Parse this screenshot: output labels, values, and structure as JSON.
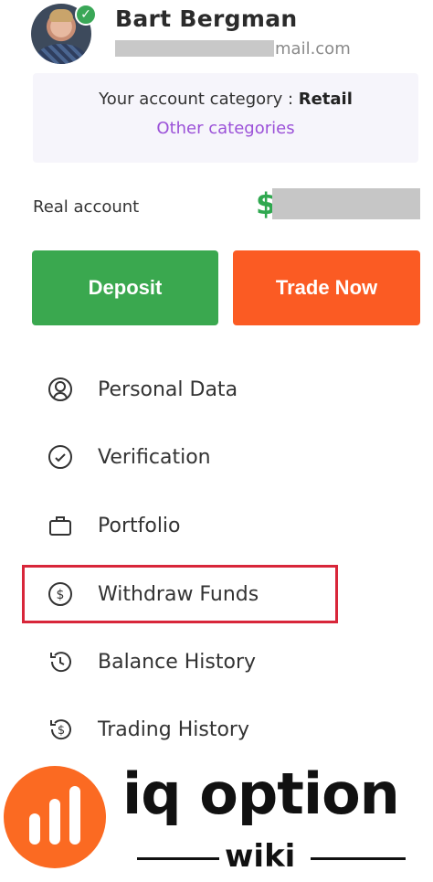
{
  "profile": {
    "name": "Bart Bergman",
    "email_visible_suffix": "mail.com"
  },
  "account_category": {
    "prefix": "Your account category : ",
    "value": "Retail",
    "other_link": "Other categories"
  },
  "balance": {
    "label": "Real account",
    "currency_symbol": "$"
  },
  "actions": {
    "deposit_label": "Deposit",
    "trade_label": "Trade Now"
  },
  "menu": [
    {
      "label": "Personal Data",
      "icon": "user-icon"
    },
    {
      "label": "Verification",
      "icon": "check-circle-icon"
    },
    {
      "label": "Portfolio",
      "icon": "briefcase-icon"
    },
    {
      "label": "Withdraw Funds",
      "icon": "dollar-circle-icon",
      "highlighted": true
    },
    {
      "label": "Balance History",
      "icon": "history-icon"
    },
    {
      "label": "Trading History",
      "icon": "dollar-history-icon"
    }
  ],
  "brand": {
    "name": "iq option",
    "sub": "wiki"
  },
  "colors": {
    "green": "#3aa84f",
    "orange": "#fb5b23",
    "purple_link": "#9b51d8",
    "highlight_red": "#d8263a"
  }
}
